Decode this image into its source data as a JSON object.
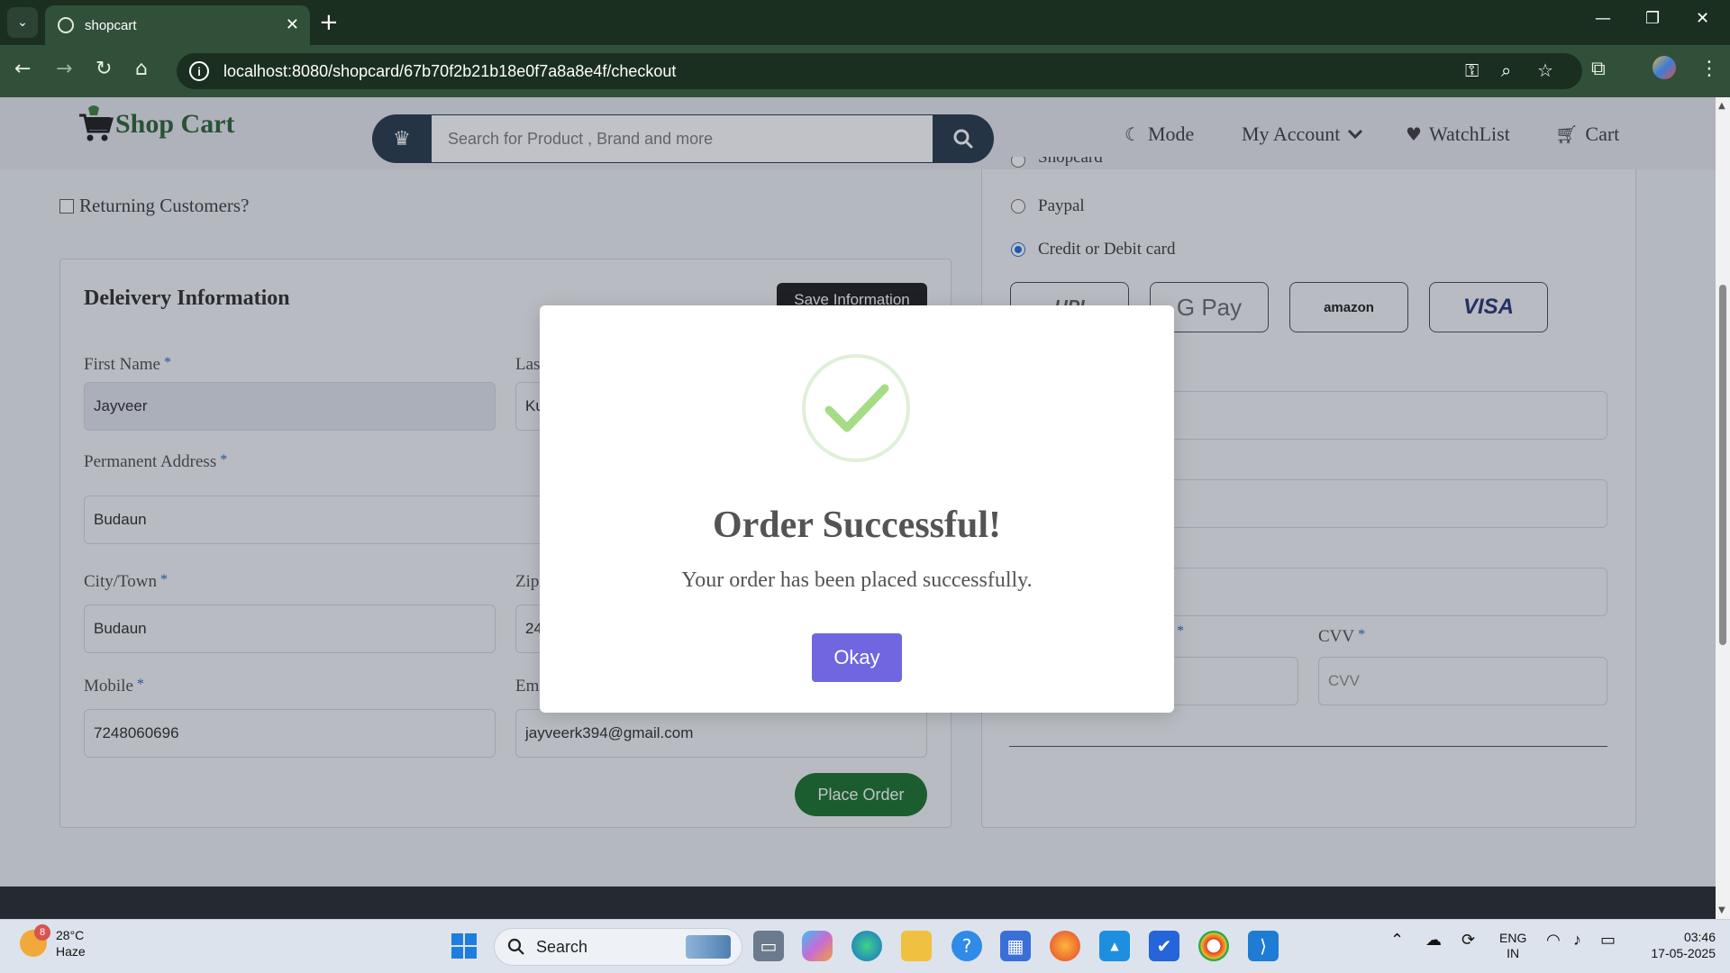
{
  "browser": {
    "tab_title": "shopcart",
    "url": "localhost:8080/shopcard/67b70f2b21b18e0f7a8a8e4f/checkout"
  },
  "header": {
    "logo_text": "Shop Cart",
    "search_placeholder": "Search for Product , Brand and more",
    "nav": {
      "mode": "Mode",
      "account": "My Account",
      "watchlist": "WatchList",
      "cart": "Cart"
    }
  },
  "checkout": {
    "returning_label": "Returning Customers?",
    "delivery": {
      "title": "Deleivery Information",
      "save_button": "Save Information",
      "first_name_label": "First Name",
      "first_name_value": "Jayveer",
      "last_name_label": "Las",
      "last_name_value": "Ku",
      "address_label": "Permanent Address",
      "address_value": "Budaun",
      "city_label": "City/Town",
      "city_value": "Budaun",
      "zip_label": "Zip",
      "zip_value": "24",
      "mobile_label": "Mobile",
      "mobile_value": "7248060696",
      "email_label": "Em",
      "email_value": "jayveerk394@gmail.com",
      "place_order": "Place Order"
    },
    "payment": {
      "option_partial": "Shopcard",
      "option_paypal": "Paypal",
      "option_card": "Credit or Debit card",
      "selected": "Credit or Debit card",
      "methods": [
        "UPI",
        "G Pay",
        "amazon",
        "VISA"
      ],
      "cvv_label": "CVV",
      "cvv_placeholder": "CVV"
    }
  },
  "modal": {
    "title": "Order Successful!",
    "message": "Your order has been placed successfully.",
    "button": "Okay"
  },
  "taskbar": {
    "weather_badge": "8",
    "temperature": "28°C",
    "condition": "Haze",
    "search_label": "Search",
    "lang_top": "ENG",
    "lang_bottom": "IN",
    "time": "03:46",
    "date": "17-05-2025"
  }
}
